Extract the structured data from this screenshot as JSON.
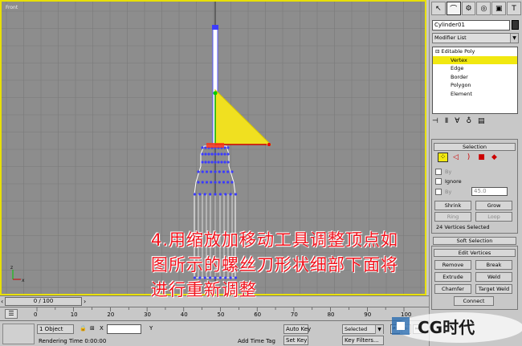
{
  "viewport": {
    "label": "Front"
  },
  "panel": {
    "object_name": "Cylinder01",
    "modifier_list": "Modifier List",
    "stack": [
      {
        "label": "Editable Poly",
        "level": "root",
        "selected": false
      },
      {
        "label": "Vertex",
        "level": "sub",
        "selected": true
      },
      {
        "label": "Edge",
        "level": "sub",
        "selected": false
      },
      {
        "label": "Border",
        "level": "sub",
        "selected": false
      },
      {
        "label": "Polygon",
        "level": "sub",
        "selected": false
      },
      {
        "label": "Element",
        "level": "sub",
        "selected": false
      }
    ],
    "selection": {
      "title": "Selection",
      "by_label": "By",
      "ignore_label": "Ignore",
      "angle_label": "By",
      "angle_value": "45.0",
      "shrink": "Shrink",
      "grow": "Grow",
      "ring": "Ring",
      "loop": "Loop",
      "status": "24 Vertices Selected"
    },
    "soft_selection": {
      "title": "Soft Selection"
    },
    "edit_vertices": {
      "title": "Edit Vertices",
      "remove": "Remove",
      "break": "Break",
      "extrude": "Extrude",
      "weld": "Weld",
      "chamfer": "Chamfer",
      "target_weld": "Target Weld",
      "connect": "Connect"
    }
  },
  "timeline": {
    "slider_text": "0 / 100",
    "ticks": [
      "0",
      "10",
      "20",
      "30",
      "40",
      "50",
      "60",
      "70",
      "80",
      "90",
      "100"
    ]
  },
  "status": {
    "objects": "1 Object",
    "x_label": "X",
    "y_label": "Y",
    "auto_key": "Auto Key",
    "selected": "Selected",
    "set_key": "Set Key",
    "key_filters": "Key Filters...",
    "rendering_time": "Rendering Time  0:00:00",
    "add_time_tag": "Add Time Tag"
  },
  "caption": {
    "line1": "4.用缩放加移动工具调整顶点如",
    "line2": "图所示的螺丝刀形状细部下面将",
    "line3": "进行重新调整"
  },
  "logo": {
    "text": "CG时代"
  },
  "colors": {
    "viewport_bg": "#8d8d8d",
    "active_border": "#e8e000",
    "selection_yellow": "#f1e810",
    "caption_red": "#f0141e",
    "vertex_blue": "#3c3cff"
  }
}
